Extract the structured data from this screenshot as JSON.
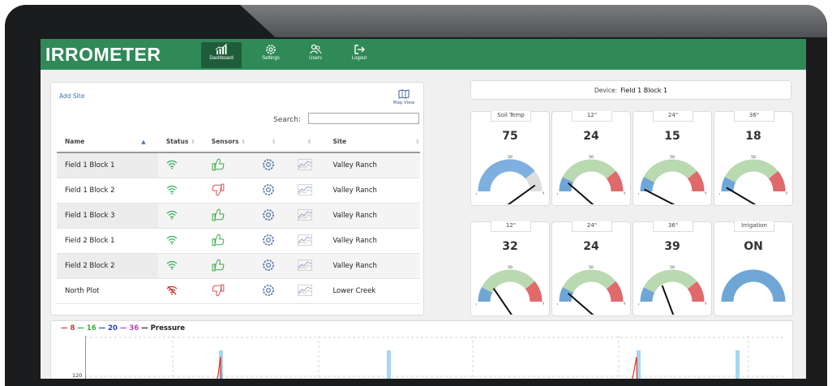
{
  "app": {
    "logo": "IRROMETER",
    "nav": [
      {
        "label": "Dashboard",
        "icon": "bar-chart-icon",
        "active": true
      },
      {
        "label": "Settings",
        "icon": "gear-icon"
      },
      {
        "label": "Users",
        "icon": "users-icon"
      },
      {
        "label": "Logout",
        "icon": "logout-icon"
      }
    ]
  },
  "sites": {
    "add_site": "Add Site",
    "map_view": "Map View",
    "search_label": "Search:",
    "search_value": "",
    "columns": [
      "Name",
      "Status",
      "Sensors",
      "",
      "",
      "Site"
    ],
    "rows": [
      {
        "name": "Field 1 Block 1",
        "status": "online",
        "sensors": "good",
        "site": "Valley Ranch"
      },
      {
        "name": "Field 1 Block 2",
        "status": "online",
        "sensors": "bad",
        "site": "Valley Ranch"
      },
      {
        "name": "Field 1 Block 3",
        "status": "online",
        "sensors": "good",
        "site": "Valley Ranch"
      },
      {
        "name": "Field 2 Block 1",
        "status": "online",
        "sensors": "good",
        "site": "Valley Ranch"
      },
      {
        "name": "Field 2 Block 2",
        "status": "online",
        "sensors": "good",
        "site": "Valley Ranch"
      },
      {
        "name": "North Plot",
        "status": "offline",
        "sensors": "bad",
        "site": "Lower Creek"
      }
    ]
  },
  "device": {
    "label": "Device:",
    "value": "Field 1 Block 1"
  },
  "gauges": [
    {
      "label": "Soil Temp",
      "value": "75",
      "scale_mid": "50",
      "scale_max": "%",
      "needle_fraction": 0.78,
      "style": "temp"
    },
    {
      "label": "12\"",
      "value": "24",
      "scale_mid": "50",
      "scale_max": "%",
      "needle_fraction": 0.25,
      "style": "moisture"
    },
    {
      "label": "24\"",
      "value": "15",
      "scale_mid": "50",
      "scale_max": "%",
      "needle_fraction": 0.17,
      "style": "moisture"
    },
    {
      "label": "36\"",
      "value": "18",
      "scale_mid": "50",
      "scale_max": "%",
      "needle_fraction": 0.19,
      "style": "moisture"
    },
    {
      "label": "12\"",
      "value": "32",
      "scale_mid": "50",
      "scale_max": "%",
      "needle_fraction": 0.33,
      "style": "moisture"
    },
    {
      "label": "24\"",
      "value": "24",
      "scale_mid": "50",
      "scale_max": "%",
      "needle_fraction": 0.25,
      "style": "moisture"
    },
    {
      "label": "36\"",
      "value": "39",
      "scale_mid": "50",
      "scale_max": "%",
      "needle_fraction": 0.4,
      "style": "moisture"
    },
    {
      "label": "Irrigation",
      "value": "ON",
      "style": "irrigation"
    }
  ],
  "chart": {
    "legend": [
      {
        "label": "8",
        "color": "#d9342b"
      },
      {
        "label": "16",
        "color": "#3aaa3a"
      },
      {
        "label": "20",
        "color": "#2b3fb5"
      },
      {
        "label": "36",
        "color": "#c23fc2"
      },
      {
        "label": "Pressure",
        "color": "#222222"
      }
    ],
    "y_tick": "120"
  },
  "colors": {
    "brand": "#2f8a57",
    "gauge_green": "#b9d9b0",
    "gauge_blue": "#6fa6d6",
    "gauge_red": "#e06a6a"
  }
}
